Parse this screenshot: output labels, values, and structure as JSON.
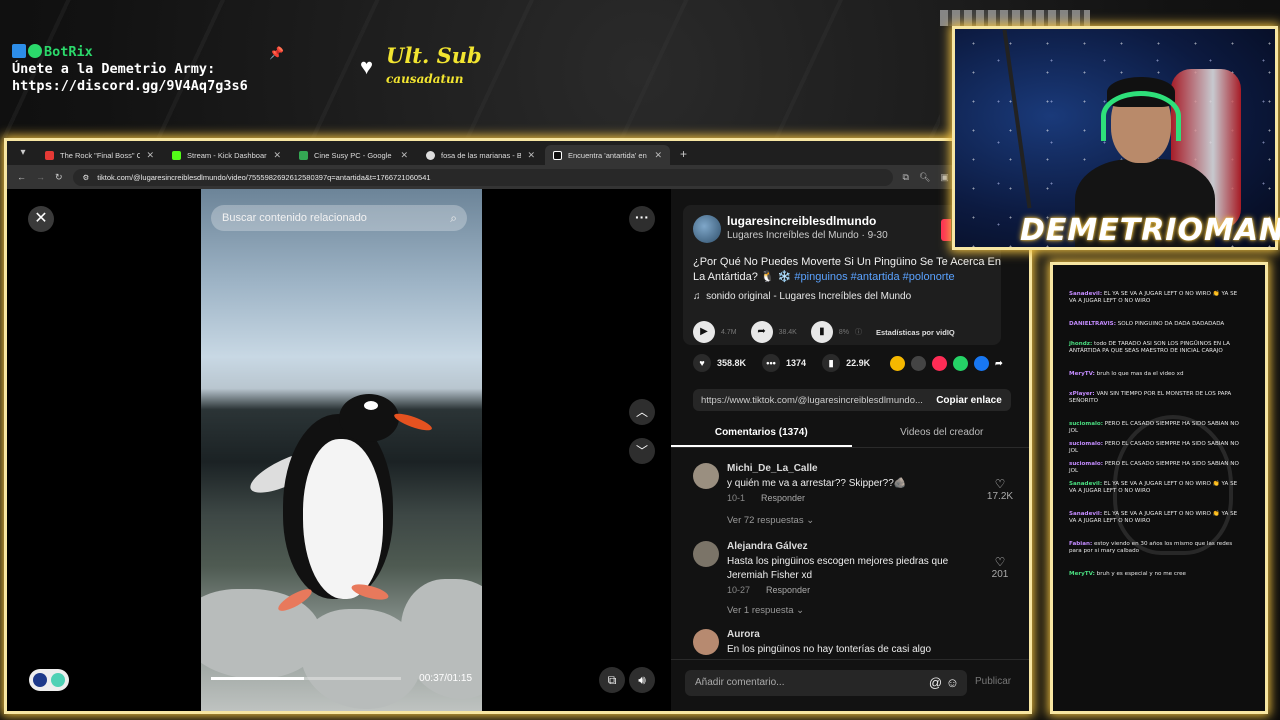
{
  "overlay": {
    "bot_name": "BotRix",
    "bot_line1": "Únete a la Demetrio Army:",
    "bot_line2": "https://discord.gg/9V4Aq7g3s6",
    "sub_title": "Ult. Sub",
    "sub_name": "causadatun",
    "streamer_name": "DEMETRIOMAN..."
  },
  "browser": {
    "tabs": [
      {
        "label": "The Rock \"Final Boss\" Custom",
        "color": "#e53935"
      },
      {
        "label": "Stream - Kick Dashboard",
        "color": "#53fc18"
      },
      {
        "label": "Cine Susy PC - Google Maps",
        "color": "#34a853"
      },
      {
        "label": "fosa de las marianas - Buscar c",
        "color": "#dddddd"
      },
      {
        "label": "Encuentra 'antartida' en Tik",
        "color": "#ffffff"
      }
    ],
    "url": "tiktok.com/@lugaresincreiblesdlmundo/video/7555982692612580397q=antartida&t=1766721060541"
  },
  "video": {
    "search_placeholder": "Buscar contenido relacionado",
    "time": "00:37/01:15",
    "progress": 0.49
  },
  "post": {
    "username": "lugaresincreiblesdlmundo",
    "display": "Lugares Increíbles del Mundo · 9-30",
    "desc_text": "¿Por Qué No Puedes Moverte Si Un Pingüino Se Te Acerca En La Antártida? 🐧 ❄️",
    "hashtags": "#pinguinos #antartida #polonorte",
    "sound": "sonido original - Lugares Increíbles del Mundo",
    "views": "4.7M",
    "shares_stat": "38.4K",
    "pct": "8%",
    "stats_label": "Estadísticas por vidIQ",
    "likes": "358.8K",
    "comments_count": "1374",
    "saves": "22.9K",
    "share_url": "https://www.tiktok.com/@lugaresincreiblesdlmundo...",
    "copy_label": "Copiar enlace",
    "tab_comments": "Comentarios (1374)",
    "tab_creator": "Videos del creador"
  },
  "comments": [
    {
      "name": "Michi_De_La_Calle",
      "text": "y quién me va a arrestar?? Skipper??🪨",
      "date": "10-1",
      "reply": "Responder",
      "likes": "17.2K",
      "more": "Ver 72 respuestas ⌄"
    },
    {
      "name": "Alejandra Gálvez",
      "text": "Hasta los pingüinos escogen mejores piedras que Jeremiah Fisher xd",
      "date": "10-27",
      "reply": "Responder",
      "likes": "201",
      "more": "Ver 1 respuesta ⌄"
    },
    {
      "name": "Aurora",
      "text": "En los pingüinos no hay tonterías de casi algo",
      "date": "",
      "reply": "",
      "likes": "",
      "more": ""
    }
  ],
  "composer": {
    "placeholder": "Añadir comentario...",
    "publish": "Publicar"
  },
  "chat": [
    {
      "user": "Sanadevil:",
      "msg": "EL YA SE VA A JUGAR LEFT O NO WIRO 👏 YA SE VA A JUGAR LEFT O NO WIRO"
    },
    {
      "user": "DANIELTRAVIS:",
      "msg": "SOLO PINGUINO DA DADA DADADADA"
    },
    {
      "user": "jhondz:",
      "msg": "todo DE TARADO ASI SON LOS PINGÜINOS EN LA ANTÁRTIDA PA QUE SEAS MAESTRO DE INICIAL CARAJO"
    },
    {
      "user": "MeryTV:",
      "msg": "bruh lo que mas da el video xd"
    },
    {
      "user": "xPlayer:",
      "msg": "VAN SIN TIEMPO POR EL MONSTER DE LOS PAPA SEÑORITO"
    },
    {
      "user": "suciomalo:",
      "msg": "PERO EL CASADO SIEMPRE HA SIDO SABIAN NO JOL"
    },
    {
      "user": "suciomalo:",
      "msg": "PERO EL CASADO SIEMPRE HA SIDO SABIAN NO JOL"
    },
    {
      "user": "suciomalo:",
      "msg": "PERO EL CASADO SIEMPRE HA SIDO SABIAN NO JOL"
    },
    {
      "user": "Sanadevil:",
      "msg": "EL YA SE VA A JUGAR LEFT O NO WIRO 👏 YA SE VA A JUGAR LEFT O NO WIRO"
    },
    {
      "user": "Sanadevil:",
      "msg": "EL YA SE VA A JUGAR LEFT O NO WIRO 👏 YA SE VA A JUGAR LEFT O NO WIRO"
    },
    {
      "user": "Fabian:",
      "msg": "estoy viendo en 30 años los mismo que las redes para por si mary calbado"
    },
    {
      "user": "MeryTV:",
      "msg": "bruh y es especial y no me cree"
    }
  ]
}
